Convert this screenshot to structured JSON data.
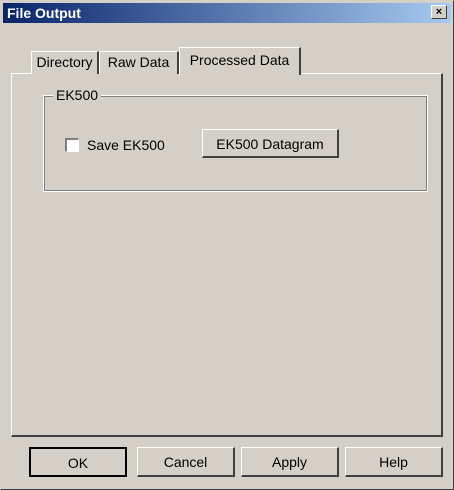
{
  "window": {
    "title": "File Output",
    "close_glyph": "×"
  },
  "tabs": [
    {
      "label": "Directory",
      "active": false
    },
    {
      "label": "Raw Data",
      "active": false
    },
    {
      "label": "Processed Data",
      "active": true
    }
  ],
  "group": {
    "label": "EK500",
    "checkbox_label": "Save EK500",
    "checkbox_checked": false,
    "datagram_button": "EK500 Datagram"
  },
  "buttons": {
    "ok": "OK",
    "cancel": "Cancel",
    "apply": "Apply",
    "help": "Help"
  }
}
